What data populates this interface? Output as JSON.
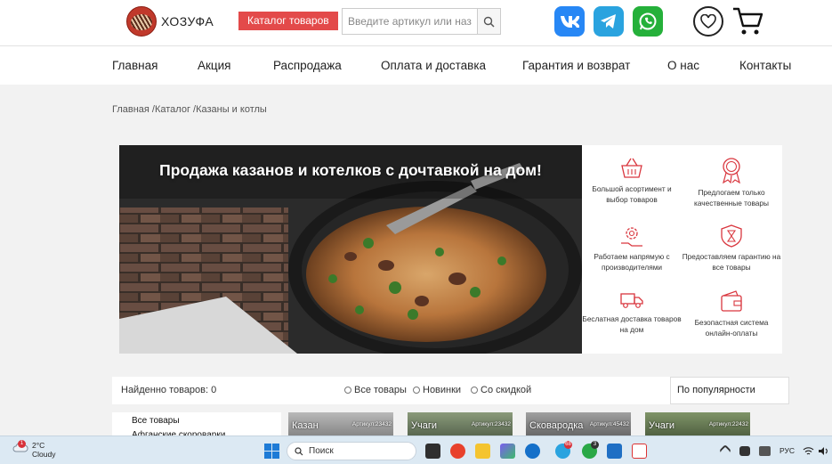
{
  "brand": {
    "name": "ХОЗУФА"
  },
  "header": {
    "catalog_button": "Каталог товаров",
    "search_placeholder": "Введите артикул или название"
  },
  "nav": [
    "Главная",
    "Акция",
    "Распродажа",
    "Оплата и доставка",
    "Гарантия и возврат",
    "О нас",
    "Контакты"
  ],
  "breadcrumbs": "Главная /Каталог /Казаны и котлы",
  "banner": {
    "title": "Продажа казанов и котелков с дочтавкой на дом!"
  },
  "features": [
    "Большой асортимент и выбор товаров",
    "Предлогаем только качественные товары",
    "Работаем напрямую с производителями",
    "Предоставляем гарантию на все товары",
    "Беслатная доставка товаров на дом",
    "Безопастная система онлайн-оплаты"
  ],
  "toolbar": {
    "found_label": "Найденно товаров: 0",
    "filters": [
      "Все товары",
      "Новинки",
      "Со скидкой"
    ],
    "sort": "По популярности"
  },
  "sidebar": [
    "Все товары",
    "Афганские скороварки"
  ],
  "products": [
    {
      "name": "Казан",
      "article": "Артикул:23432"
    },
    {
      "name": "Учаги",
      "article": "Артикул:23432"
    },
    {
      "name": "Сковародка",
      "article": "Артикул:45432"
    },
    {
      "name": "Учаги",
      "article": "Артикул:22432"
    }
  ],
  "taskbar": {
    "temp": "2°C",
    "condition": "Cloudy",
    "weather_badge": "1",
    "search": "Поиск",
    "lang": "РУС",
    "badges": [
      "68",
      "3"
    ]
  },
  "colors": {
    "accent": "#e34a4a",
    "vk": "#2787f5",
    "telegram": "#2aa3df",
    "whatsapp": "#25b03a"
  }
}
